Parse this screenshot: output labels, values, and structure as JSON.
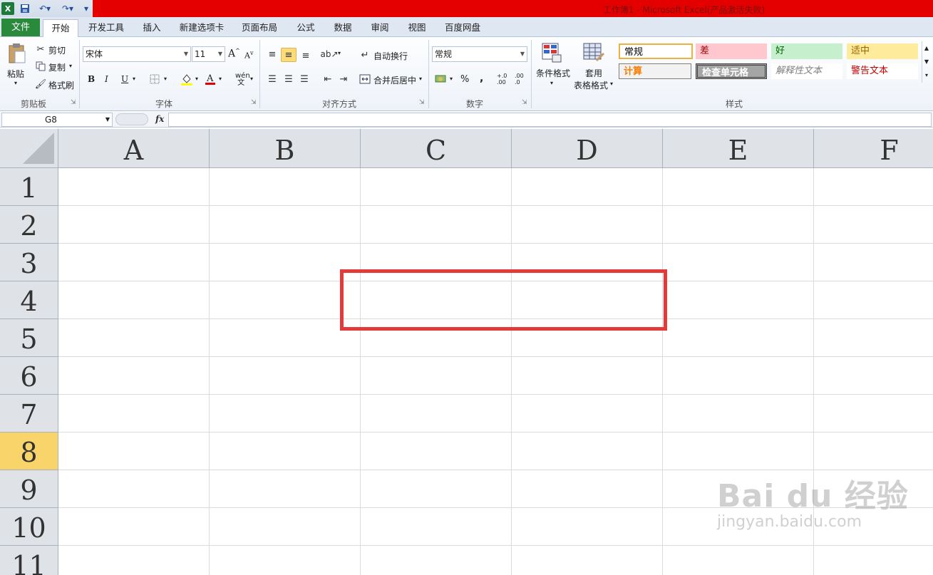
{
  "titlebar": {
    "title": "工作簿1 - Microsoft Excel(产品激活失败)",
    "quick_access": {
      "excel_icon": "X",
      "save_icon": "save-icon",
      "undo": "↶▾",
      "redo": "↷▾",
      "more": "▾"
    }
  },
  "tabs": {
    "file": "文件",
    "items": [
      "开始",
      "开发工具",
      "插入",
      "新建选项卡",
      "页面布局",
      "公式",
      "数据",
      "审阅",
      "视图",
      "百度网盘"
    ],
    "active": "开始"
  },
  "ribbon": {
    "clipboard": {
      "label": "剪贴板",
      "paste": "粘贴",
      "cut": "剪切",
      "copy": "复制",
      "format_painter": "格式刷"
    },
    "font": {
      "label": "字体",
      "font_name": "宋体",
      "font_size": "11",
      "bold": "B",
      "italic": "I",
      "underline": "U",
      "grow": "A",
      "shrink": "A"
    },
    "alignment": {
      "label": "对齐方式",
      "wrap": "自动换行",
      "merge": "合并后居中"
    },
    "number": {
      "label": "数字",
      "format": "常规",
      "percent": "%",
      "comma": ",",
      "inc_decimal": "+.0 .00",
      "dec_decimal": ".00 .0"
    },
    "styles": {
      "label": "样式",
      "conditional": "条件格式",
      "table_format_1": "套用",
      "table_format_2": "表格格式",
      "cells": [
        {
          "text": "常规",
          "bg": "#ffffff",
          "color": "#000000"
        },
        {
          "text": "差",
          "bg": "#ffc7ce",
          "color": "#9c0006"
        },
        {
          "text": "好",
          "bg": "#c6efce",
          "color": "#006100"
        },
        {
          "text": "适中",
          "bg": "#ffeb9c",
          "color": "#9c6500"
        },
        {
          "text": "计算",
          "bg": "#f2f2f2",
          "color": "#fa7d00"
        },
        {
          "text": "检查单元格",
          "bg": "#a5a5a5",
          "color": "#ffffff"
        },
        {
          "text": "解释性文本",
          "bg": "#ffffff",
          "color": "#7f7f7f"
        },
        {
          "text": "警告文本",
          "bg": "#ffffff",
          "color": "#c00000"
        }
      ]
    }
  },
  "formula_bar": {
    "name_box": "G8",
    "fx": "fx",
    "value": ""
  },
  "grid": {
    "columns": [
      "A",
      "B",
      "C",
      "D",
      "E",
      "F"
    ],
    "rows": [
      "1",
      "2",
      "3",
      "4",
      "5",
      "6",
      "7",
      "8",
      "9",
      "10",
      "11"
    ],
    "selected_row": "8"
  },
  "watermark": {
    "brand": "Bai du 经验",
    "url": "jingyan.baidu.com"
  }
}
